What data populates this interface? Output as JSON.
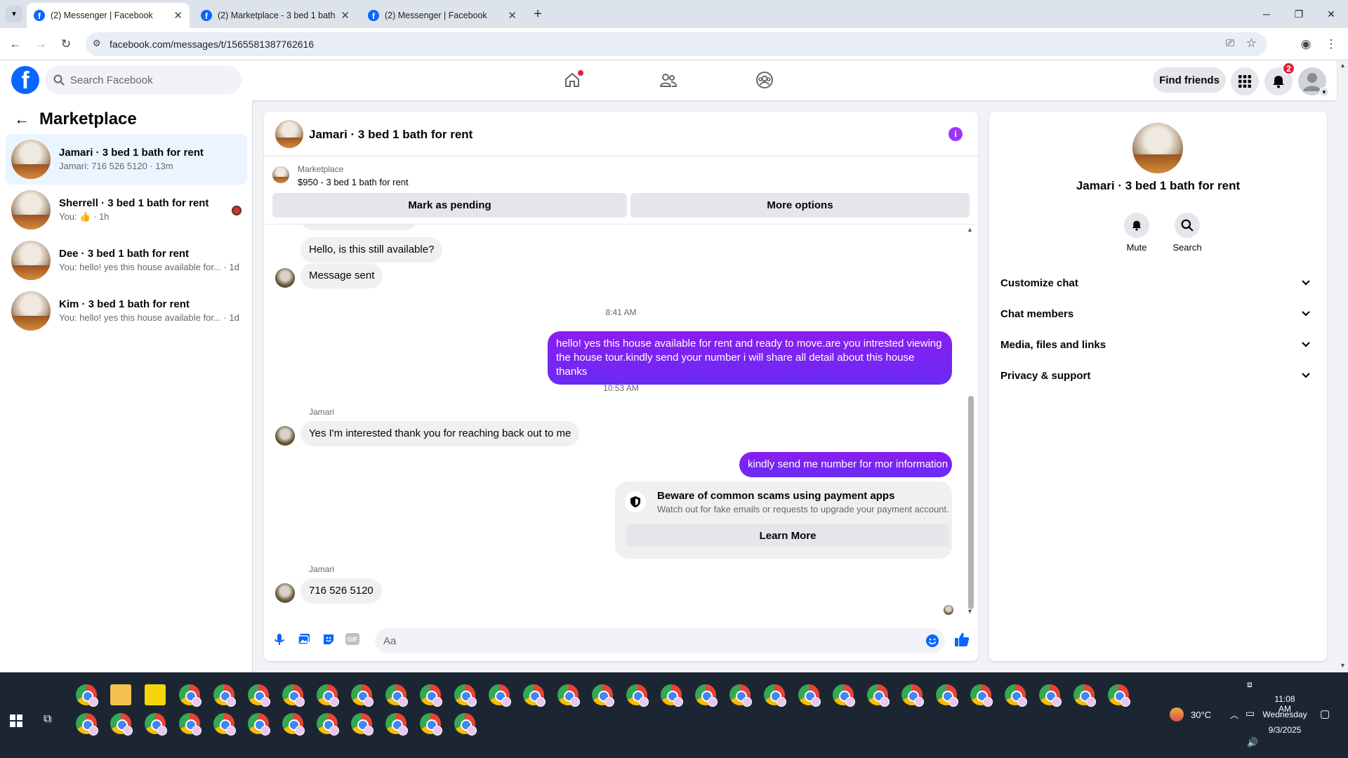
{
  "browser": {
    "tabs": [
      {
        "title": "(2) Messenger | Facebook",
        "active": true
      },
      {
        "title": "(2) Marketplace - 3 bed 1 bath",
        "active": false
      },
      {
        "title": "(2) Messenger | Facebook",
        "active": false
      }
    ],
    "new_tab": "+",
    "url": "facebook.com/messages/t/1565581387762616"
  },
  "header": {
    "search_placeholder": "Search Facebook",
    "find_friends": "Find friends",
    "notifications_count": "2"
  },
  "sidebar": {
    "title": "Marketplace",
    "conversations": [
      {
        "name": "Jamari · 3 bed 1 bath for rent",
        "preview": "Jamari: 716 526 5120 · 13m",
        "selected": true
      },
      {
        "name": "Sherrell · 3 bed 1 bath for rent",
        "preview_prefix": "You:",
        "preview_suffix": "· 1h",
        "selected": false
      },
      {
        "name": "Dee · 3 bed 1 bath for rent",
        "preview": "You: hello! yes this house available for...",
        "time": "· 1d",
        "selected": false
      },
      {
        "name": "Kim · 3 bed 1 bath for rent",
        "preview": "You: hello! yes this house available for...",
        "time": "· 1d",
        "selected": false
      }
    ]
  },
  "chat": {
    "title": "Jamari · 3 bed 1 bath for rent",
    "listing_source": "Marketplace",
    "listing_detail": "$950 - 3 bed 1 bath for rent",
    "mark_pending": "Mark as pending",
    "more_options": "More options",
    "messages": {
      "m1": "Hello, is this still available?",
      "m2": "Message sent",
      "time1": "8:41 AM",
      "m3_line1": "hello! yes this house available for rent and ready to move.are you intrested viewing",
      "m3_line2": "the house tour.kindly send your number i will share all detail about this house thanks",
      "time2": "10:53 AM",
      "sender1": "Jamari",
      "m4": "Yes I'm interested thank you for reaching back out to me",
      "m5": "kindly send me number for mor information",
      "scam_title": "Beware of common scams using payment apps",
      "scam_text": "Watch out for fake emails or requests to upgrade your payment account.",
      "learn_more": "Learn More",
      "sender2": "Jamari",
      "m6": "716 526 5120"
    },
    "composer_placeholder": "Aa"
  },
  "details": {
    "title": "Jamari · 3 bed 1 bath for rent",
    "mute": "Mute",
    "search": "Search",
    "sections": [
      "Customize chat",
      "Chat members",
      "Media, files and links",
      "Privacy & support"
    ]
  },
  "taskbar": {
    "weather": "30°C",
    "time": "11:08 AM",
    "day": "Wednesday",
    "date": "9/3/2025"
  },
  "colors": {
    "brand_blue": "#0866ff",
    "outgoing_bubble": "#7b2ff0",
    "selected_row": "#ebf5ff"
  }
}
